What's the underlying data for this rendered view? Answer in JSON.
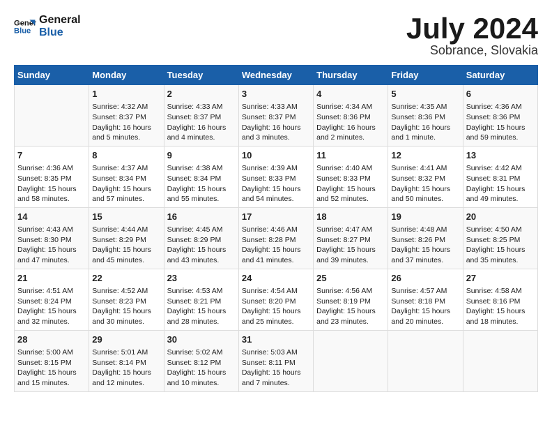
{
  "header": {
    "logo": {
      "line1": "General",
      "line2": "Blue"
    },
    "month": "July 2024",
    "location": "Sobrance, Slovakia"
  },
  "weekdays": [
    "Sunday",
    "Monday",
    "Tuesday",
    "Wednesday",
    "Thursday",
    "Friday",
    "Saturday"
  ],
  "weeks": [
    [
      {
        "day": "",
        "content": ""
      },
      {
        "day": "1",
        "content": "Sunrise: 4:32 AM\nSunset: 8:37 PM\nDaylight: 16 hours\nand 5 minutes."
      },
      {
        "day": "2",
        "content": "Sunrise: 4:33 AM\nSunset: 8:37 PM\nDaylight: 16 hours\nand 4 minutes."
      },
      {
        "day": "3",
        "content": "Sunrise: 4:33 AM\nSunset: 8:37 PM\nDaylight: 16 hours\nand 3 minutes."
      },
      {
        "day": "4",
        "content": "Sunrise: 4:34 AM\nSunset: 8:36 PM\nDaylight: 16 hours\nand 2 minutes."
      },
      {
        "day": "5",
        "content": "Sunrise: 4:35 AM\nSunset: 8:36 PM\nDaylight: 16 hours\nand 1 minute."
      },
      {
        "day": "6",
        "content": "Sunrise: 4:36 AM\nSunset: 8:36 PM\nDaylight: 15 hours\nand 59 minutes."
      }
    ],
    [
      {
        "day": "7",
        "content": "Sunrise: 4:36 AM\nSunset: 8:35 PM\nDaylight: 15 hours\nand 58 minutes."
      },
      {
        "day": "8",
        "content": "Sunrise: 4:37 AM\nSunset: 8:34 PM\nDaylight: 15 hours\nand 57 minutes."
      },
      {
        "day": "9",
        "content": "Sunrise: 4:38 AM\nSunset: 8:34 PM\nDaylight: 15 hours\nand 55 minutes."
      },
      {
        "day": "10",
        "content": "Sunrise: 4:39 AM\nSunset: 8:33 PM\nDaylight: 15 hours\nand 54 minutes."
      },
      {
        "day": "11",
        "content": "Sunrise: 4:40 AM\nSunset: 8:33 PM\nDaylight: 15 hours\nand 52 minutes."
      },
      {
        "day": "12",
        "content": "Sunrise: 4:41 AM\nSunset: 8:32 PM\nDaylight: 15 hours\nand 50 minutes."
      },
      {
        "day": "13",
        "content": "Sunrise: 4:42 AM\nSunset: 8:31 PM\nDaylight: 15 hours\nand 49 minutes."
      }
    ],
    [
      {
        "day": "14",
        "content": "Sunrise: 4:43 AM\nSunset: 8:30 PM\nDaylight: 15 hours\nand 47 minutes."
      },
      {
        "day": "15",
        "content": "Sunrise: 4:44 AM\nSunset: 8:29 PM\nDaylight: 15 hours\nand 45 minutes."
      },
      {
        "day": "16",
        "content": "Sunrise: 4:45 AM\nSunset: 8:29 PM\nDaylight: 15 hours\nand 43 minutes."
      },
      {
        "day": "17",
        "content": "Sunrise: 4:46 AM\nSunset: 8:28 PM\nDaylight: 15 hours\nand 41 minutes."
      },
      {
        "day": "18",
        "content": "Sunrise: 4:47 AM\nSunset: 8:27 PM\nDaylight: 15 hours\nand 39 minutes."
      },
      {
        "day": "19",
        "content": "Sunrise: 4:48 AM\nSunset: 8:26 PM\nDaylight: 15 hours\nand 37 minutes."
      },
      {
        "day": "20",
        "content": "Sunrise: 4:50 AM\nSunset: 8:25 PM\nDaylight: 15 hours\nand 35 minutes."
      }
    ],
    [
      {
        "day": "21",
        "content": "Sunrise: 4:51 AM\nSunset: 8:24 PM\nDaylight: 15 hours\nand 32 minutes."
      },
      {
        "day": "22",
        "content": "Sunrise: 4:52 AM\nSunset: 8:23 PM\nDaylight: 15 hours\nand 30 minutes."
      },
      {
        "day": "23",
        "content": "Sunrise: 4:53 AM\nSunset: 8:21 PM\nDaylight: 15 hours\nand 28 minutes."
      },
      {
        "day": "24",
        "content": "Sunrise: 4:54 AM\nSunset: 8:20 PM\nDaylight: 15 hours\nand 25 minutes."
      },
      {
        "day": "25",
        "content": "Sunrise: 4:56 AM\nSunset: 8:19 PM\nDaylight: 15 hours\nand 23 minutes."
      },
      {
        "day": "26",
        "content": "Sunrise: 4:57 AM\nSunset: 8:18 PM\nDaylight: 15 hours\nand 20 minutes."
      },
      {
        "day": "27",
        "content": "Sunrise: 4:58 AM\nSunset: 8:16 PM\nDaylight: 15 hours\nand 18 minutes."
      }
    ],
    [
      {
        "day": "28",
        "content": "Sunrise: 5:00 AM\nSunset: 8:15 PM\nDaylight: 15 hours\nand 15 minutes."
      },
      {
        "day": "29",
        "content": "Sunrise: 5:01 AM\nSunset: 8:14 PM\nDaylight: 15 hours\nand 12 minutes."
      },
      {
        "day": "30",
        "content": "Sunrise: 5:02 AM\nSunset: 8:12 PM\nDaylight: 15 hours\nand 10 minutes."
      },
      {
        "day": "31",
        "content": "Sunrise: 5:03 AM\nSunset: 8:11 PM\nDaylight: 15 hours\nand 7 minutes."
      },
      {
        "day": "",
        "content": ""
      },
      {
        "day": "",
        "content": ""
      },
      {
        "day": "",
        "content": ""
      }
    ]
  ]
}
